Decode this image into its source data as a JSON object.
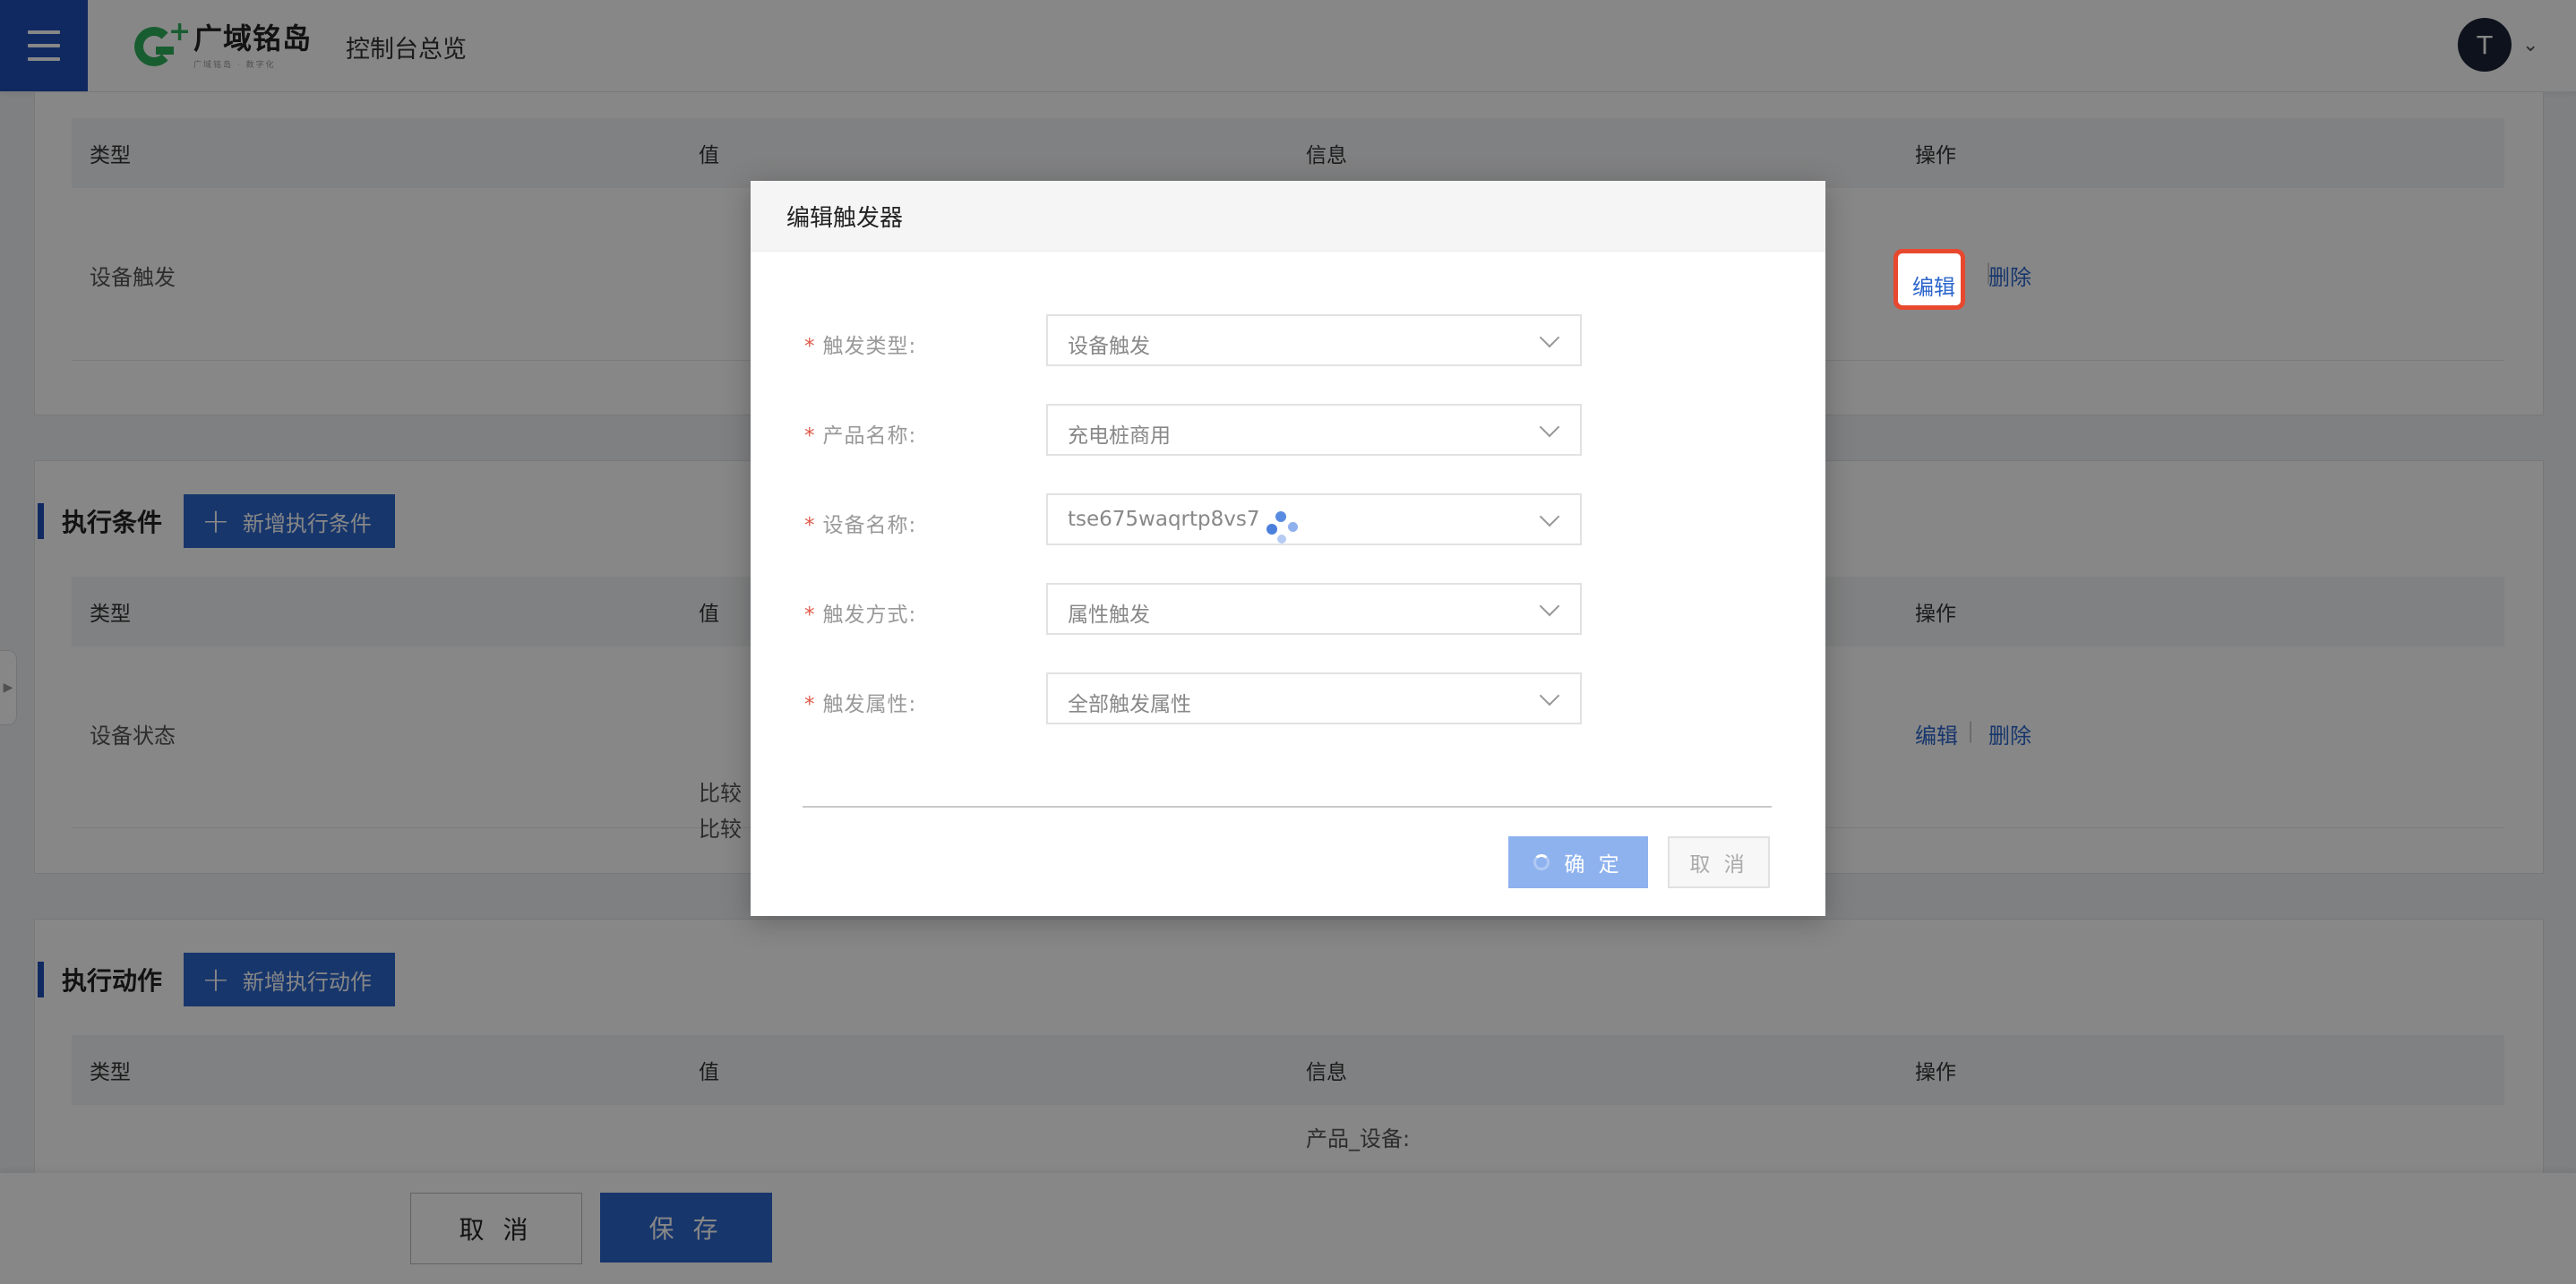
{
  "header": {
    "menu_icon": "hamburger-icon",
    "logo_name": "广域铭岛",
    "logo_slogan": "广域铭岛 · 数字化",
    "console_title": "控制台总览",
    "avatar_initial": "T",
    "accent_color": "#1f4fb8"
  },
  "trigger_table": {
    "columns": [
      "类型",
      "值",
      "信息",
      "操作"
    ],
    "rows": [
      {
        "type": "设备触发",
        "edit": "编辑",
        "delete": "删除"
      }
    ]
  },
  "conditions": {
    "title": "执行条件",
    "add_label": "新增执行条件",
    "columns": [
      "类型",
      "值",
      "操作"
    ],
    "rows": [
      {
        "type": "设备状态",
        "value_line1": "比较",
        "value_line2": "比较",
        "edit": "编辑",
        "delete": "删除"
      }
    ]
  },
  "actions": {
    "title": "执行动作",
    "add_label": "新增执行动作",
    "columns": [
      "类型",
      "值",
      "信息",
      "操作"
    ],
    "rows": [
      {
        "info_line1": "产品_设备:"
      }
    ]
  },
  "footer": {
    "cancel_label": "取 消",
    "save_label": "保 存"
  },
  "modal": {
    "title": "编辑触发器",
    "required_mark": "*",
    "fields": [
      {
        "label": "触发类型:",
        "value": "设备触发"
      },
      {
        "label": "产品名称:",
        "value": "充电桩商用"
      },
      {
        "label": "设备名称:",
        "value": "tse675waqrtp8vs7"
      },
      {
        "label": "触发方式:",
        "value": "属性触发"
      },
      {
        "label": "触发属性:",
        "value": "全部触发属性"
      }
    ],
    "confirm_label": "确 定",
    "cancel_label": "取 消"
  }
}
